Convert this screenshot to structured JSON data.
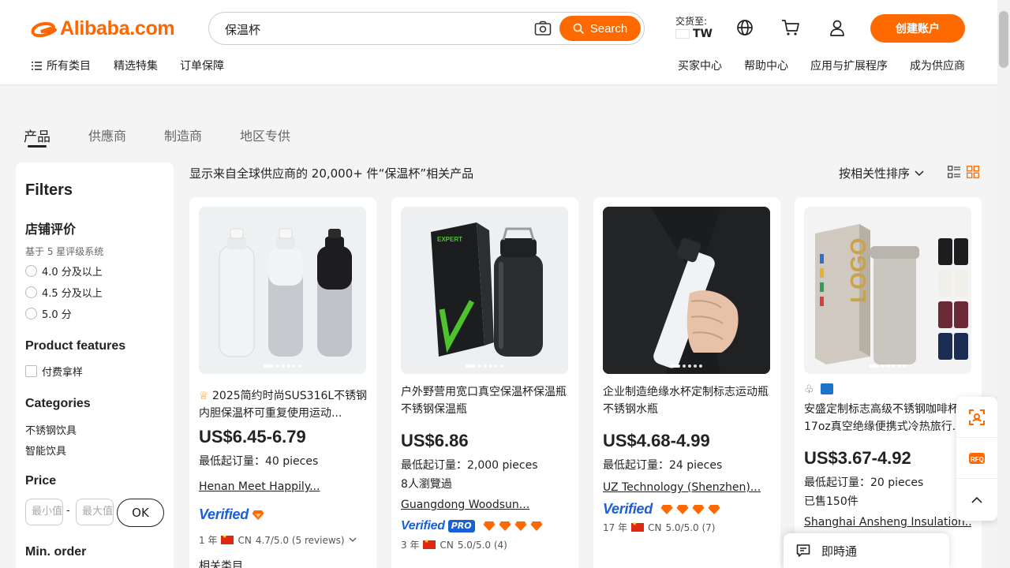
{
  "header": {
    "logo": "Alibaba.com",
    "search_value": "保温杯",
    "search_button": "Search",
    "deliver_label": "交货至:",
    "deliver_country": "TW",
    "signup_button": "创建账户",
    "nav_left": [
      "所有类目",
      "精选特集",
      "订单保障"
    ],
    "nav_right": [
      "买家中心",
      "帮助中心",
      "应用与扩展程序",
      "成为供应商"
    ]
  },
  "tabs": [
    "产品",
    "供應商",
    "制造商",
    "地区专供"
  ],
  "sidebar": {
    "title": "Filters",
    "rating_heading": "店铺评价",
    "rating_note": "基于 5 星评级系统",
    "rating_options": [
      "4.0 分及以上",
      "4.5 分及以上",
      "5.0 分"
    ],
    "features_heading": "Product features",
    "features_option": "付费拿样",
    "categories_heading": "Categories",
    "categories": [
      "不锈钢饮具",
      "智能饮具"
    ],
    "price_heading": "Price",
    "price_min_placeholder": "最小值",
    "price_max_placeholder": "最大值",
    "price_separator": "-",
    "ok_button": "OK",
    "moq_heading": "Min. order"
  },
  "main": {
    "results_text": "显示来自全球供应商的 20,000+ 件“保温杯”相关产品",
    "sort_label": "按相关性排序"
  },
  "products": [
    {
      "title": "2025简约时尚SUS316L不锈钢内胆保温杯可重复使用运动...",
      "price": "US$6.45-6.79",
      "moq_label": "最低起订量：",
      "moq_value": "40 pieces",
      "extra": "",
      "supplier": "Henan Meet Happily...",
      "verified": "Verified",
      "years": "1 年",
      "country": "CN",
      "rating": "4.7/5.0 (5 reviews)",
      "bottom_text": "相关类目"
    },
    {
      "title": "户外野营用宽口真空保温杯保温瓶不锈钢保温瓶",
      "price": "US$6.86",
      "moq_label": "最低起订量：",
      "moq_value": "2,000 pieces",
      "extra": "8人瀏覽過",
      "supplier": "Guangdong Woodsun...",
      "verified": "Verified",
      "pro": "PRO",
      "years": "3 年",
      "country": "CN",
      "rating": "5.0/5.0 (4)"
    },
    {
      "title": "企业制造绝缘水杯定制标志运动瓶不锈钢水瓶",
      "price": "US$4.68-4.99",
      "moq_label": "最低起订量：",
      "moq_value": "24 pieces",
      "extra": "",
      "supplier": "UZ Technology (Shenzhen)...",
      "verified": "Verified",
      "years": "17 年",
      "country": "CN",
      "rating": "5.0/5.0 (7)"
    },
    {
      "title": "安盛定制标志高级不锈钢咖啡杯17oz真空绝缘便携式冷热旅行...",
      "price": "US$3.67-4.92",
      "moq_label": "最低起订量：",
      "moq_value": "20 pieces",
      "extra": "已售150件",
      "supplier": "Shanghai Ansheng Insulation..."
    }
  ],
  "chat_label": "即時通",
  "colors": {
    "accent": "#ff6a00",
    "verified": "#1a5fd6"
  }
}
